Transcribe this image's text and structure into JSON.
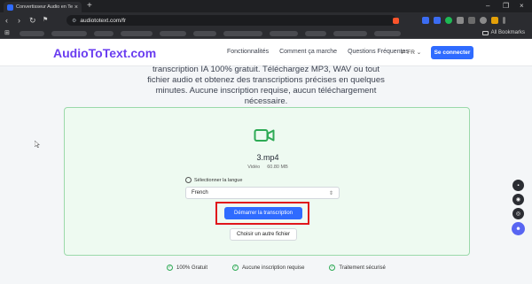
{
  "browser": {
    "tab_title": "Convertisseur Audio en Texte Gr",
    "url": "audiototext.com/fr",
    "bookmarks_label": "All Bookmarks"
  },
  "header": {
    "logo": "AudioToText.com",
    "nav": [
      "Fonctionnalités",
      "Comment ça marche",
      "Questions Fréquentes"
    ],
    "language": "FR",
    "connect": "Se connecter"
  },
  "intro_text": "transcription IA 100% gratuit. Téléchargez MP3, WAV ou tout fichier audio et obtenez des transcriptions précises en quelques minutes. Aucune inscription requise, aucun téléchargement nécessaire.",
  "upload": {
    "file_name": "3.mp4",
    "file_type": "Vidéo",
    "file_size": "60.80 MB",
    "language_label": "Sélectionner la langue",
    "language_value": "French",
    "start_button": "Démarrer la transcription",
    "other_file_button": "Choisir un autre fichier"
  },
  "features": [
    "100% Gratuit",
    "Aucune inscription requise",
    "Traitement sécurisé"
  ],
  "colors": {
    "brand": "#6a3df0",
    "primary": "#2f6bff",
    "card_bg": "#eefaf1",
    "card_border": "#9bd9aa",
    "video_icon": "#2eaa55",
    "highlight": "#e0161b"
  }
}
